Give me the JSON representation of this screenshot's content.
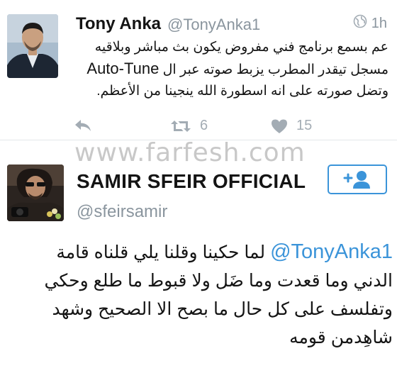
{
  "tweet1": {
    "author_name": "Tony Anka",
    "handle": "@TonyAnka1",
    "timestamp": "1h",
    "lines": [
      "عم بسمع برنامج فني مفروض يكون بث مباشر وبلاقيه",
      "مسجل تيقدر المطرب يزبط صوته عبر ال",
      "وتضل صورته على انه اسطورة الله ينجينا من الأعظم."
    ],
    "inline_latin": "Auto-Tune",
    "retweet_count": "6",
    "like_count": "15",
    "icons": {
      "globe": "globe-icon",
      "reply": "reply-icon",
      "retweet": "retweet-icon",
      "like": "heart-icon"
    }
  },
  "watermark": "www.farfesh.com",
  "tweet2": {
    "author_name": "SAMIR SFEIR OFFICIAL",
    "handle": "@sfeirsamir",
    "follow_icon": "add-user-icon",
    "mention": "@TonyAnka1",
    "line1_rest": "لما حكينا وقلنا يلي قلناه قامة",
    "lines": [
      "الدني وما قعدت وما ضَل ولا قبوط ما طلع وحكي",
      "وتفلسف على كل حال ما بصح الا الصحيح وشهد",
      "شاهِدمن قومه"
    ]
  },
  "colors": {
    "accent": "#3b94d9",
    "muted": "#8a959e",
    "icon_muted": "#a3acb4",
    "text": "#141414"
  }
}
